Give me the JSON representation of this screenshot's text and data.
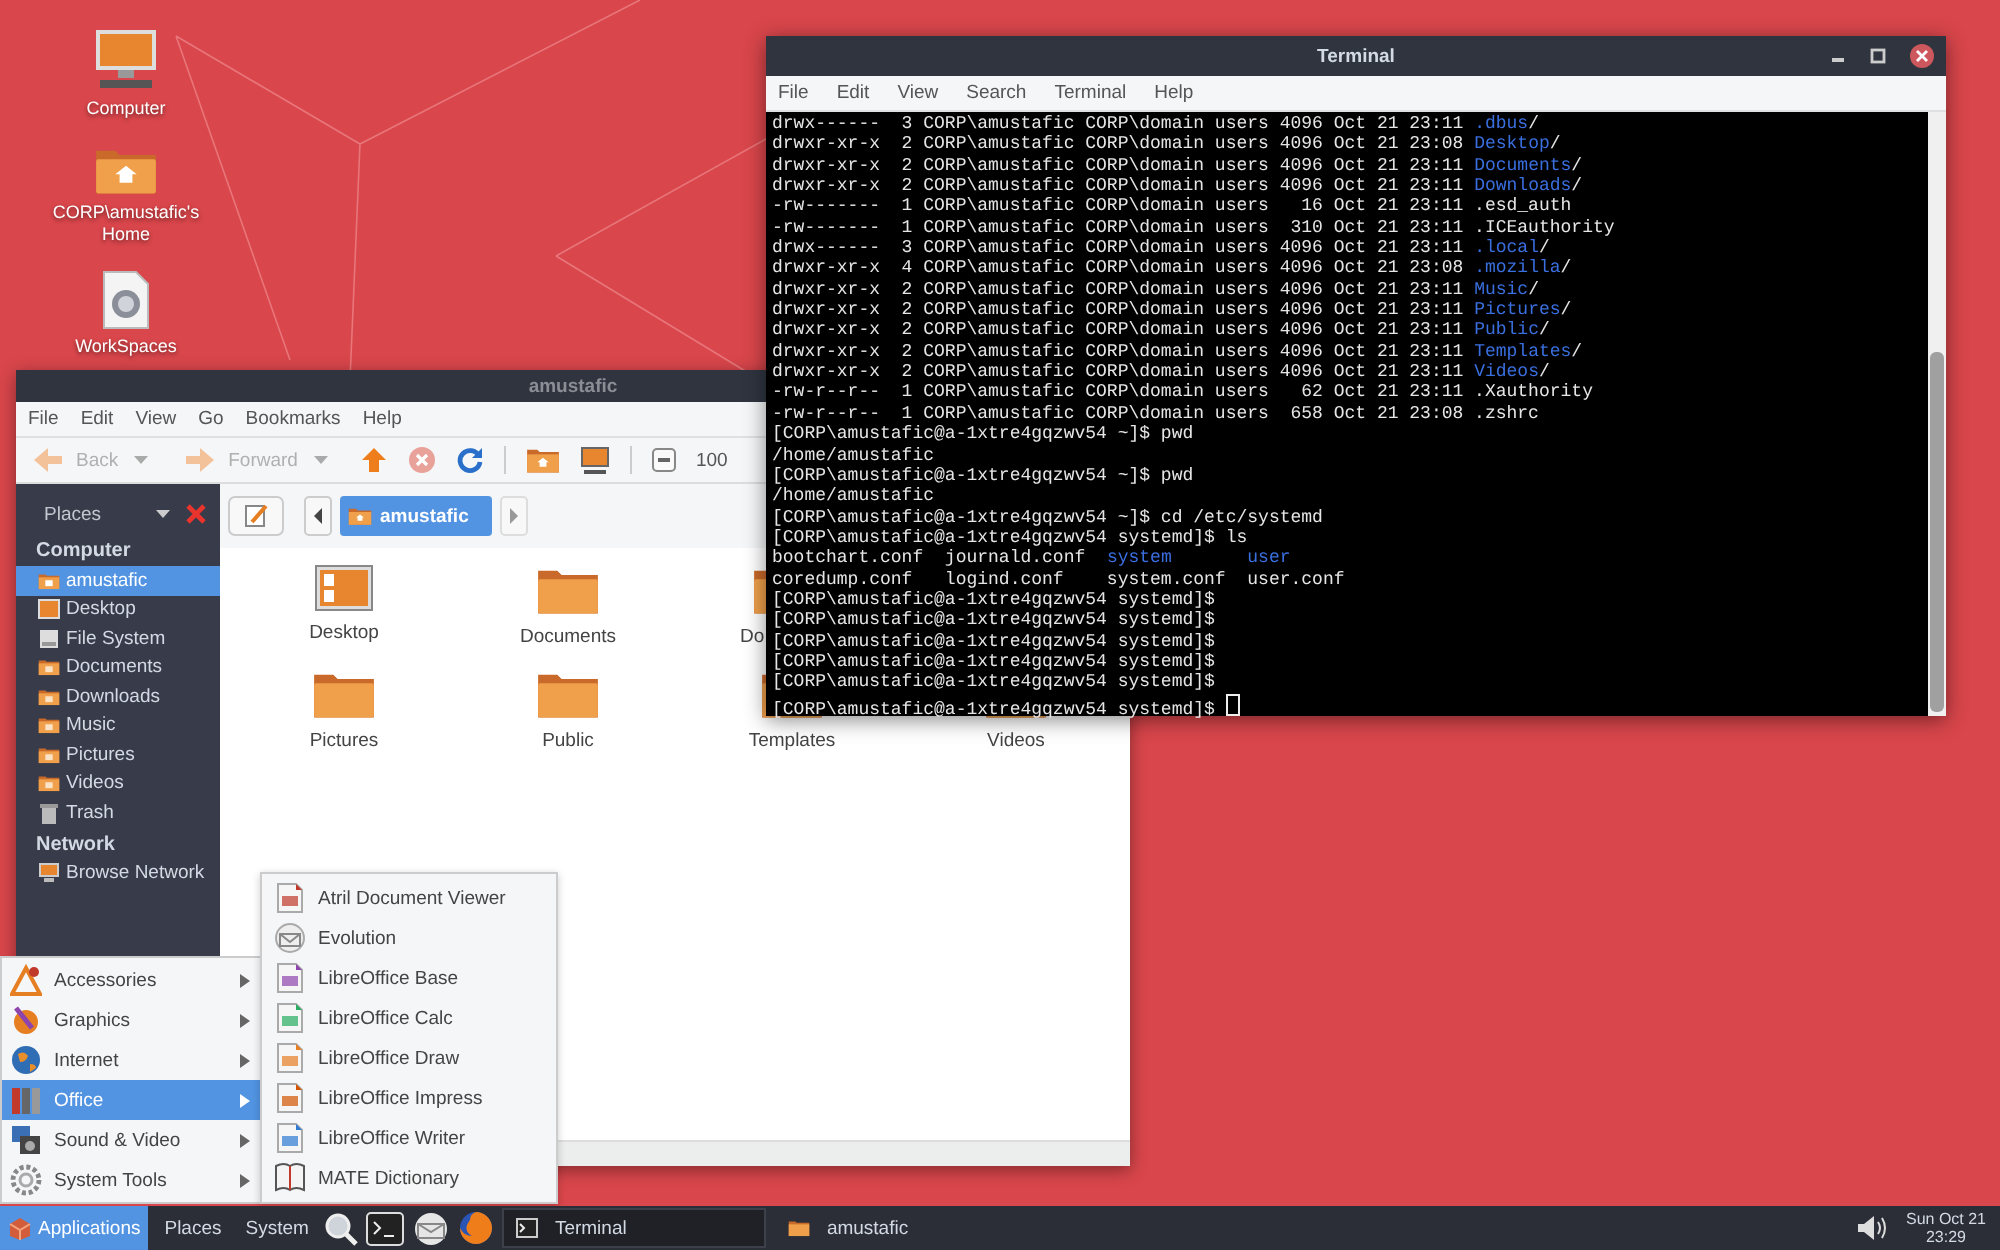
{
  "desktop_icons": [
    {
      "label": "Computer",
      "kind": "computer"
    },
    {
      "label": "CORP\\amustafic's Home",
      "kind": "home"
    },
    {
      "label": "WorkSpaces",
      "kind": "file"
    }
  ],
  "file_manager": {
    "title": "amustafic",
    "menu": [
      "File",
      "Edit",
      "View",
      "Go",
      "Bookmarks",
      "Help"
    ],
    "nav_buttons": [
      {
        "label": "Back",
        "kind": "back",
        "disabled": true
      },
      {
        "label": "Forward",
        "kind": "forward",
        "disabled": true
      }
    ],
    "zoom_level": "100",
    "sidebar": {
      "title": "Places",
      "sections": [
        {
          "heading": "Computer",
          "items": [
            {
              "label": "amustafic",
              "kind": "home",
              "selected": true
            },
            {
              "label": "Desktop",
              "kind": "desktop",
              "selected": false
            },
            {
              "label": "File System",
              "kind": "drive",
              "selected": false
            },
            {
              "label": "Documents",
              "kind": "folder",
              "selected": false
            },
            {
              "label": "Downloads",
              "kind": "folder",
              "selected": false
            },
            {
              "label": "Music",
              "kind": "folder",
              "selected": false
            },
            {
              "label": "Pictures",
              "kind": "folder",
              "selected": false
            },
            {
              "label": "Videos",
              "kind": "folder",
              "selected": false
            },
            {
              "label": "Trash",
              "kind": "trash",
              "selected": false
            }
          ]
        },
        {
          "heading": "Network",
          "items": [
            {
              "label": "Browse Network",
              "kind": "network",
              "selected": false
            }
          ]
        }
      ]
    },
    "path": {
      "current": "amustafic"
    },
    "file_rows": [
      [
        {
          "label": "Desktop",
          "kind": "desktop"
        },
        {
          "label": "Documents",
          "kind": "folder"
        },
        {
          "label": "Do",
          "kind": "folder"
        }
      ],
      [
        {
          "label": "Pictures",
          "kind": "folder"
        },
        {
          "label": "Public",
          "kind": "folder"
        },
        {
          "label": "Templates",
          "kind": "folder"
        },
        {
          "label": "Videos",
          "kind": "folder"
        }
      ]
    ]
  },
  "terminal": {
    "title": "Terminal",
    "menu": [
      "File",
      "Edit",
      "View",
      "Search",
      "Terminal",
      "Help"
    ],
    "lines": [
      {
        "segments": [
          {
            "text": "drwx------  3 CORP\\amustafic CORP\\domain users 4096 Oct 21 23:11 ",
            "kind": "text"
          },
          {
            "text": ".dbus",
            "kind": "dir"
          },
          {
            "text": "/",
            "kind": "text"
          }
        ]
      },
      {
        "segments": [
          {
            "text": "drwxr-xr-x  2 CORP\\amustafic CORP\\domain users 4096 Oct 21 23:08 ",
            "kind": "text"
          },
          {
            "text": "Desktop",
            "kind": "dir"
          },
          {
            "text": "/",
            "kind": "text"
          }
        ]
      },
      {
        "segments": [
          {
            "text": "drwxr-xr-x  2 CORP\\amustafic CORP\\domain users 4096 Oct 21 23:11 ",
            "kind": "text"
          },
          {
            "text": "Documents",
            "kind": "dir"
          },
          {
            "text": "/",
            "kind": "text"
          }
        ]
      },
      {
        "segments": [
          {
            "text": "drwxr-xr-x  2 CORP\\amustafic CORP\\domain users 4096 Oct 21 23:11 ",
            "kind": "text"
          },
          {
            "text": "Downloads",
            "kind": "dir"
          },
          {
            "text": "/",
            "kind": "text"
          }
        ]
      },
      {
        "segments": [
          {
            "text": "-rw-------  1 CORP\\amustafic CORP\\domain users   16 Oct 21 23:11 .esd_auth",
            "kind": "text"
          }
        ]
      },
      {
        "segments": [
          {
            "text": "-rw-------  1 CORP\\amustafic CORP\\domain users  310 Oct 21 23:11 .ICEauthority",
            "kind": "text"
          }
        ]
      },
      {
        "segments": [
          {
            "text": "drwx------  3 CORP\\amustafic CORP\\domain users 4096 Oct 21 23:11 ",
            "kind": "text"
          },
          {
            "text": ".local",
            "kind": "dir"
          },
          {
            "text": "/",
            "kind": "text"
          }
        ]
      },
      {
        "segments": [
          {
            "text": "drwxr-xr-x  4 CORP\\amustafic CORP\\domain users 4096 Oct 21 23:08 ",
            "kind": "text"
          },
          {
            "text": ".mozilla",
            "kind": "dir"
          },
          {
            "text": "/",
            "kind": "text"
          }
        ]
      },
      {
        "segments": [
          {
            "text": "drwxr-xr-x  2 CORP\\amustafic CORP\\domain users 4096 Oct 21 23:11 ",
            "kind": "text"
          },
          {
            "text": "Music",
            "kind": "dir"
          },
          {
            "text": "/",
            "kind": "text"
          }
        ]
      },
      {
        "segments": [
          {
            "text": "drwxr-xr-x  2 CORP\\amustafic CORP\\domain users 4096 Oct 21 23:11 ",
            "kind": "text"
          },
          {
            "text": "Pictures",
            "kind": "dir"
          },
          {
            "text": "/",
            "kind": "text"
          }
        ]
      },
      {
        "segments": [
          {
            "text": "drwxr-xr-x  2 CORP\\amustafic CORP\\domain users 4096 Oct 21 23:11 ",
            "kind": "text"
          },
          {
            "text": "Public",
            "kind": "dir"
          },
          {
            "text": "/",
            "kind": "text"
          }
        ]
      },
      {
        "segments": [
          {
            "text": "drwxr-xr-x  2 CORP\\amustafic CORP\\domain users 4096 Oct 21 23:11 ",
            "kind": "text"
          },
          {
            "text": "Templates",
            "kind": "dir"
          },
          {
            "text": "/",
            "kind": "text"
          }
        ]
      },
      {
        "segments": [
          {
            "text": "drwxr-xr-x  2 CORP\\amustafic CORP\\domain users 4096 Oct 21 23:11 ",
            "kind": "text"
          },
          {
            "text": "Videos",
            "kind": "dir"
          },
          {
            "text": "/",
            "kind": "text"
          }
        ]
      },
      {
        "segments": [
          {
            "text": "-rw-r--r--  1 CORP\\amustafic CORP\\domain users   62 Oct 21 23:11 .Xauthority",
            "kind": "text"
          }
        ]
      },
      {
        "segments": [
          {
            "text": "-rw-r--r--  1 CORP\\amustafic CORP\\domain users  658 Oct 21 23:08 .zshrc",
            "kind": "text"
          }
        ]
      },
      {
        "segments": [
          {
            "text": "[CORP\\amustafic@a-1xtre4gqzwv54 ~]$ pwd",
            "kind": "text"
          }
        ]
      },
      {
        "segments": [
          {
            "text": "/home/amustafic",
            "kind": "text"
          }
        ]
      },
      {
        "segments": [
          {
            "text": "[CORP\\amustafic@a-1xtre4gqzwv54 ~]$ pwd",
            "kind": "text"
          }
        ]
      },
      {
        "segments": [
          {
            "text": "/home/amustafic",
            "kind": "text"
          }
        ]
      },
      {
        "segments": [
          {
            "text": "[CORP\\amustafic@a-1xtre4gqzwv54 ~]$ cd /etc/systemd",
            "kind": "text"
          }
        ]
      },
      {
        "segments": [
          {
            "text": "[CORP\\amustafic@a-1xtre4gqzwv54 systemd]$ ls",
            "kind": "text"
          }
        ]
      },
      {
        "segments": [
          {
            "text": "bootchart.conf  journald.conf  ",
            "kind": "text"
          },
          {
            "text": "system       ",
            "kind": "dir"
          },
          {
            "text": "user",
            "kind": "dir"
          }
        ]
      },
      {
        "segments": [
          {
            "text": "coredump.conf   logind.conf    system.conf  user.conf",
            "kind": "text"
          }
        ]
      },
      {
        "segments": [
          {
            "text": "[CORP\\amustafic@a-1xtre4gqzwv54 systemd]$",
            "kind": "text"
          }
        ]
      },
      {
        "segments": [
          {
            "text": "[CORP\\amustafic@a-1xtre4gqzwv54 systemd]$",
            "kind": "text"
          }
        ]
      },
      {
        "segments": [
          {
            "text": "[CORP\\amustafic@a-1xtre4gqzwv54 systemd]$",
            "kind": "text"
          }
        ]
      },
      {
        "segments": [
          {
            "text": "[CORP\\amustafic@a-1xtre4gqzwv54 systemd]$",
            "kind": "text"
          }
        ]
      },
      {
        "segments": [
          {
            "text": "[CORP\\amustafic@a-1xtre4gqzwv54 systemd]$",
            "kind": "text"
          }
        ]
      },
      {
        "segments": [
          {
            "text": "[CORP\\amustafic@a-1xtre4gqzwv54 systemd]$ ",
            "kind": "text"
          }
        ]
      }
    ]
  },
  "apps_menu": {
    "categories": [
      {
        "label": "Accessories",
        "kind": "accessories",
        "selected": false
      },
      {
        "label": "Graphics",
        "kind": "graphics",
        "selected": false
      },
      {
        "label": "Internet",
        "kind": "internet",
        "selected": false
      },
      {
        "label": "Office",
        "kind": "office",
        "selected": true
      },
      {
        "label": "Sound & Video",
        "kind": "sound",
        "selected": false
      },
      {
        "label": "System Tools",
        "kind": "system",
        "selected": false
      }
    ],
    "submenu": [
      {
        "label": "Atril Document Viewer",
        "kind": "viewer"
      },
      {
        "label": "Evolution",
        "kind": "mail"
      },
      {
        "label": "LibreOffice Base",
        "kind": "base"
      },
      {
        "label": "LibreOffice Calc",
        "kind": "calc"
      },
      {
        "label": "LibreOffice Draw",
        "kind": "draw"
      },
      {
        "label": "LibreOffice Impress",
        "kind": "impress"
      },
      {
        "label": "LibreOffice Writer",
        "kind": "writer"
      },
      {
        "label": "MATE Dictionary",
        "kind": "dictionary"
      }
    ]
  },
  "taskbar": {
    "menus": [
      {
        "label": "Applications",
        "selected": true
      },
      {
        "label": "Places",
        "selected": false
      },
      {
        "label": "System",
        "selected": false
      }
    ],
    "tasks": [
      {
        "label": "Terminal",
        "kind": "terminal",
        "selected": true
      },
      {
        "label": "amustafic",
        "kind": "folder",
        "selected": false
      }
    ],
    "clock": {
      "date": "Sun Oct 21",
      "time": "23:29"
    }
  }
}
